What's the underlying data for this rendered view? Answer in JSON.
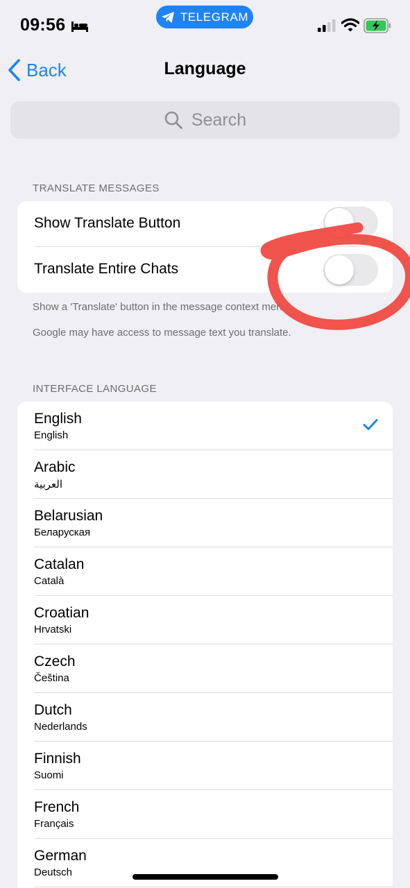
{
  "status_bar": {
    "time": "09:56",
    "app_pill": "TELEGRAM",
    "pill_color": "#1f83f6",
    "icons": [
      "bed-icon",
      "telegram-icon",
      "signal-icon",
      "wifi-icon",
      "battery-charging-icon"
    ]
  },
  "nav": {
    "back_label": "Back",
    "title": "Language"
  },
  "search": {
    "placeholder": "Search"
  },
  "translate": {
    "header": "TRANSLATE MESSAGES",
    "rows": [
      {
        "label": "Show Translate Button",
        "on": false
      },
      {
        "label": "Translate Entire Chats",
        "on": false
      }
    ],
    "footer_1": "Show a 'Translate' button in the message context menu.",
    "footer_2": "Google may have access to message text you translate."
  },
  "interface": {
    "header": "INTERFACE LANGUAGE",
    "languages": [
      {
        "name": "English",
        "native": "English",
        "selected": true
      },
      {
        "name": "Arabic",
        "native": "العربية",
        "selected": false
      },
      {
        "name": "Belarusian",
        "native": "Беларуская",
        "selected": false
      },
      {
        "name": "Catalan",
        "native": "Català",
        "selected": false
      },
      {
        "name": "Croatian",
        "native": "Hrvatski",
        "selected": false
      },
      {
        "name": "Czech",
        "native": "Čeština",
        "selected": false
      },
      {
        "name": "Dutch",
        "native": "Nederlands",
        "selected": false
      },
      {
        "name": "Finnish",
        "native": "Suomi",
        "selected": false
      },
      {
        "name": "French",
        "native": "Français",
        "selected": false
      },
      {
        "name": "German",
        "native": "Deutsch",
        "selected": false
      }
    ]
  },
  "colors": {
    "accent": "#1f83f6",
    "annotation": "#f04a43",
    "background": "#efeff4"
  }
}
